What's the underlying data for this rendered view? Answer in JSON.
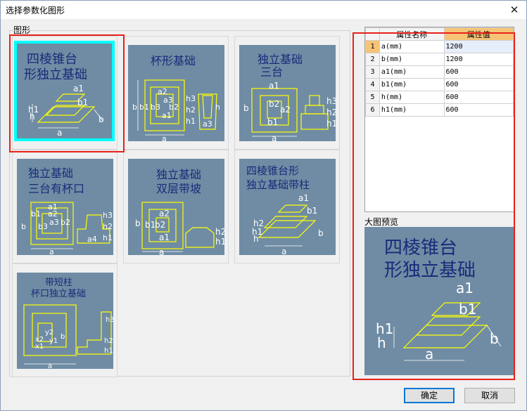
{
  "window": {
    "title": "选择参数化图形",
    "close_glyph": "✕"
  },
  "shapes_group": {
    "label": "图形"
  },
  "tiles": [
    {
      "label": "四棱锥台形独立基础",
      "title_lines": [
        "四棱锥台",
        "形独立基础"
      ],
      "dims": [
        "a1",
        "b1",
        "h1",
        "h",
        "a",
        "b"
      ]
    },
    {
      "label": "杯形基础",
      "title_lines": [
        "杯形基础"
      ],
      "dims": [
        "a2",
        "a3",
        "b3",
        "b2",
        "a1",
        "a",
        "b",
        "b1",
        "h3",
        "h2",
        "h1",
        "a3",
        "h"
      ]
    },
    {
      "label": "独立基础三台",
      "title_lines": [
        "独立基础",
        "三台"
      ],
      "dims": [
        "a1",
        "b2",
        "a2",
        "b1",
        "a",
        "b",
        "h3",
        "h2",
        "h1"
      ]
    },
    {
      "label": "独立基础三台有杯口",
      "title_lines": [
        "独立基础",
        "三台有杯口"
      ],
      "dims": [
        "a1",
        "a2",
        "a3",
        "b1",
        "b2",
        "b3",
        "b",
        "a",
        "a4",
        "h3",
        "h2",
        "h1"
      ]
    },
    {
      "label": "独立基础双层带坡",
      "title_lines": [
        "独立基础",
        "双层带坡"
      ],
      "dims": [
        "a2",
        "b2",
        "b1",
        "b",
        "a1",
        "a",
        "h2",
        "h1"
      ]
    },
    {
      "label": "四棱锥台形独立基础带柱",
      "title_lines": [
        "四棱锥台形",
        "独立基础带柱"
      ],
      "dims": [
        "a1",
        "b1",
        "h2",
        "h1",
        "h",
        "a",
        "b"
      ]
    },
    {
      "label": "带短柱杯口独立基础",
      "title_lines": [
        "带短柱",
        "杯口独立基础"
      ],
      "dims": [
        "x2",
        "y2",
        "x1",
        "y1",
        "b",
        "a",
        "h3",
        "h2",
        "h1"
      ]
    }
  ],
  "property_grid": {
    "headers": [
      "属性名称",
      "属性值"
    ],
    "rows": [
      {
        "num": "1",
        "name": "a(mm)",
        "value": "1200"
      },
      {
        "num": "2",
        "name": "b(mm)",
        "value": "1200"
      },
      {
        "num": "3",
        "name": "a1(mm)",
        "value": "600"
      },
      {
        "num": "4",
        "name": "b1(mm)",
        "value": "600"
      },
      {
        "num": "5",
        "name": "h(mm)",
        "value": "600"
      },
      {
        "num": "6",
        "name": "h1(mm)",
        "value": "600"
      }
    ]
  },
  "preview": {
    "label": "大图预览",
    "title_lines": [
      "四棱锥台",
      "形独立基础"
    ],
    "dims": [
      "a1",
      "b1",
      "h1",
      "h",
      "a",
      "b"
    ]
  },
  "buttons": {
    "ok": "确定",
    "cancel": "取消"
  },
  "colors": {
    "accent_selected": "#00ffff",
    "highlight_frame": "#e8201a",
    "drawing_bg": "#6f8ca4",
    "drawing_line": "#ffff00",
    "drawing_title": "#1a2a7a"
  },
  "selected_tile_index": 0,
  "selected_row_index": 0
}
